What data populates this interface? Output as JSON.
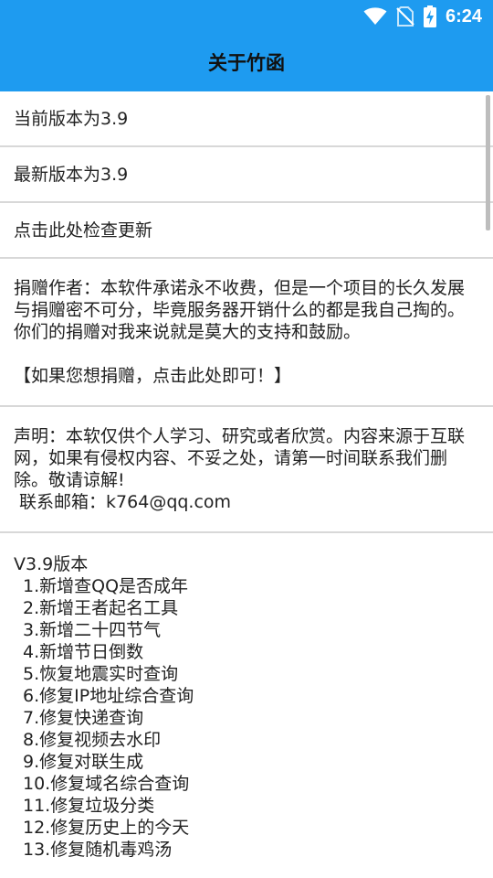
{
  "status_bar": {
    "time": "6:24",
    "icons": [
      "wifi-icon",
      "no-sim-icon",
      "battery-charging-icon"
    ],
    "bar_color": "#1e9bf0"
  },
  "app_bar": {
    "title": "关于竹函"
  },
  "version": {
    "current": "当前版本为3.9",
    "latest": "最新版本为3.9",
    "check_update": "点击此处检查更新"
  },
  "donation": {
    "text": "捐赠作者：本软件承诺永不收费，但是一个项目的长久发展与捐赠密不可分，毕竟服务器开销什么的都是我自己掏的。你们的捐赠对我来说就是莫大的支持和鼓励。",
    "link": "【如果您想捐赠，点击此处即可！】"
  },
  "disclaimer": {
    "text": "声明：本软仅供个人学习、研究或者欣赏。内容来源于互联网，如果有侵权内容、不妥之处，请第一时间联系我们删除。敬请谅解!",
    "contact": " 联系邮箱：k764@qq.com"
  },
  "changelog": {
    "title": "V3.9版本",
    "items": [
      "1.新增查QQ是否成年",
      "2.新增王者起名工具",
      "3.新增二十四节气",
      "4.新增节日倒数",
      "5.恢复地震实时查询",
      "6.修复IP地址综合查询",
      "7.修复快递查询",
      "8.修复视频去水印",
      "9.修复对联生成",
      "10.修复域名综合查询",
      "11.修复垃圾分类",
      "12.修复历史上的今天",
      "13.修复随机毒鸡汤"
    ]
  }
}
